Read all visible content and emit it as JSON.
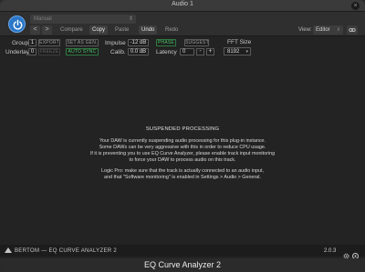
{
  "window": {
    "title": "Audio 1",
    "close_label": "×"
  },
  "host": {
    "preset_value": "Manual",
    "back_label": "<",
    "forward_label": ">",
    "compare_label": "Compare",
    "copy_label": "Copy",
    "paste_label": "Paste",
    "undo_label": "Undo",
    "redo_label": "Redo",
    "view_label": "View:",
    "view_value": "Editor",
    "link_icon": "link-icon",
    "power_icon": "power-icon",
    "accent": "#2b78c8"
  },
  "controls": {
    "group_label": "Group",
    "group_value": "1",
    "export_label": "EXPORT",
    "underlay_label": "Underlay",
    "underlay_value": "0",
    "freeze_label": "FREEZE",
    "set_as_gen_label": "SET AS GEN.",
    "auto_sync_label": "AUTO SYNC",
    "impulse_label": "Impulse",
    "impulse_value": "-12 dB",
    "calib_label": "Calib.",
    "calib_value": "0.0 dB",
    "phase_label": "PHASE",
    "suggest_label": "SUGGEST",
    "latency_label": "Latency",
    "latency_value": "0",
    "minus_label": "-",
    "plus_label": "+",
    "fft_label": "FFT Size",
    "fft_value": "8192",
    "active_color": "#48c465"
  },
  "message": {
    "heading": "SUSPENDED PROCESSING",
    "lines": [
      "Your DAW is currently suspending audio processing for this plug-in instance.",
      "Some DAWs can be very aggressive with this in order to reduce CPU usage.",
      "If it is preventing you to use EQ Curve Analyzer, please enable track input monitoring",
      "to force your DAW to process audio on this track.",
      "Logic Pro: make sure that the track is actually connected to an audio input,",
      "and that \"Software monitoring\" is enabled in Settings > Audio > General."
    ]
  },
  "footer": {
    "brand": "BERTOM — EQ CURVE ANALYZER 2",
    "version": "2.0.3",
    "settings_icon": "gear-icon",
    "help_icon": "help-icon"
  },
  "bottom_title": "EQ Curve Analyzer 2"
}
